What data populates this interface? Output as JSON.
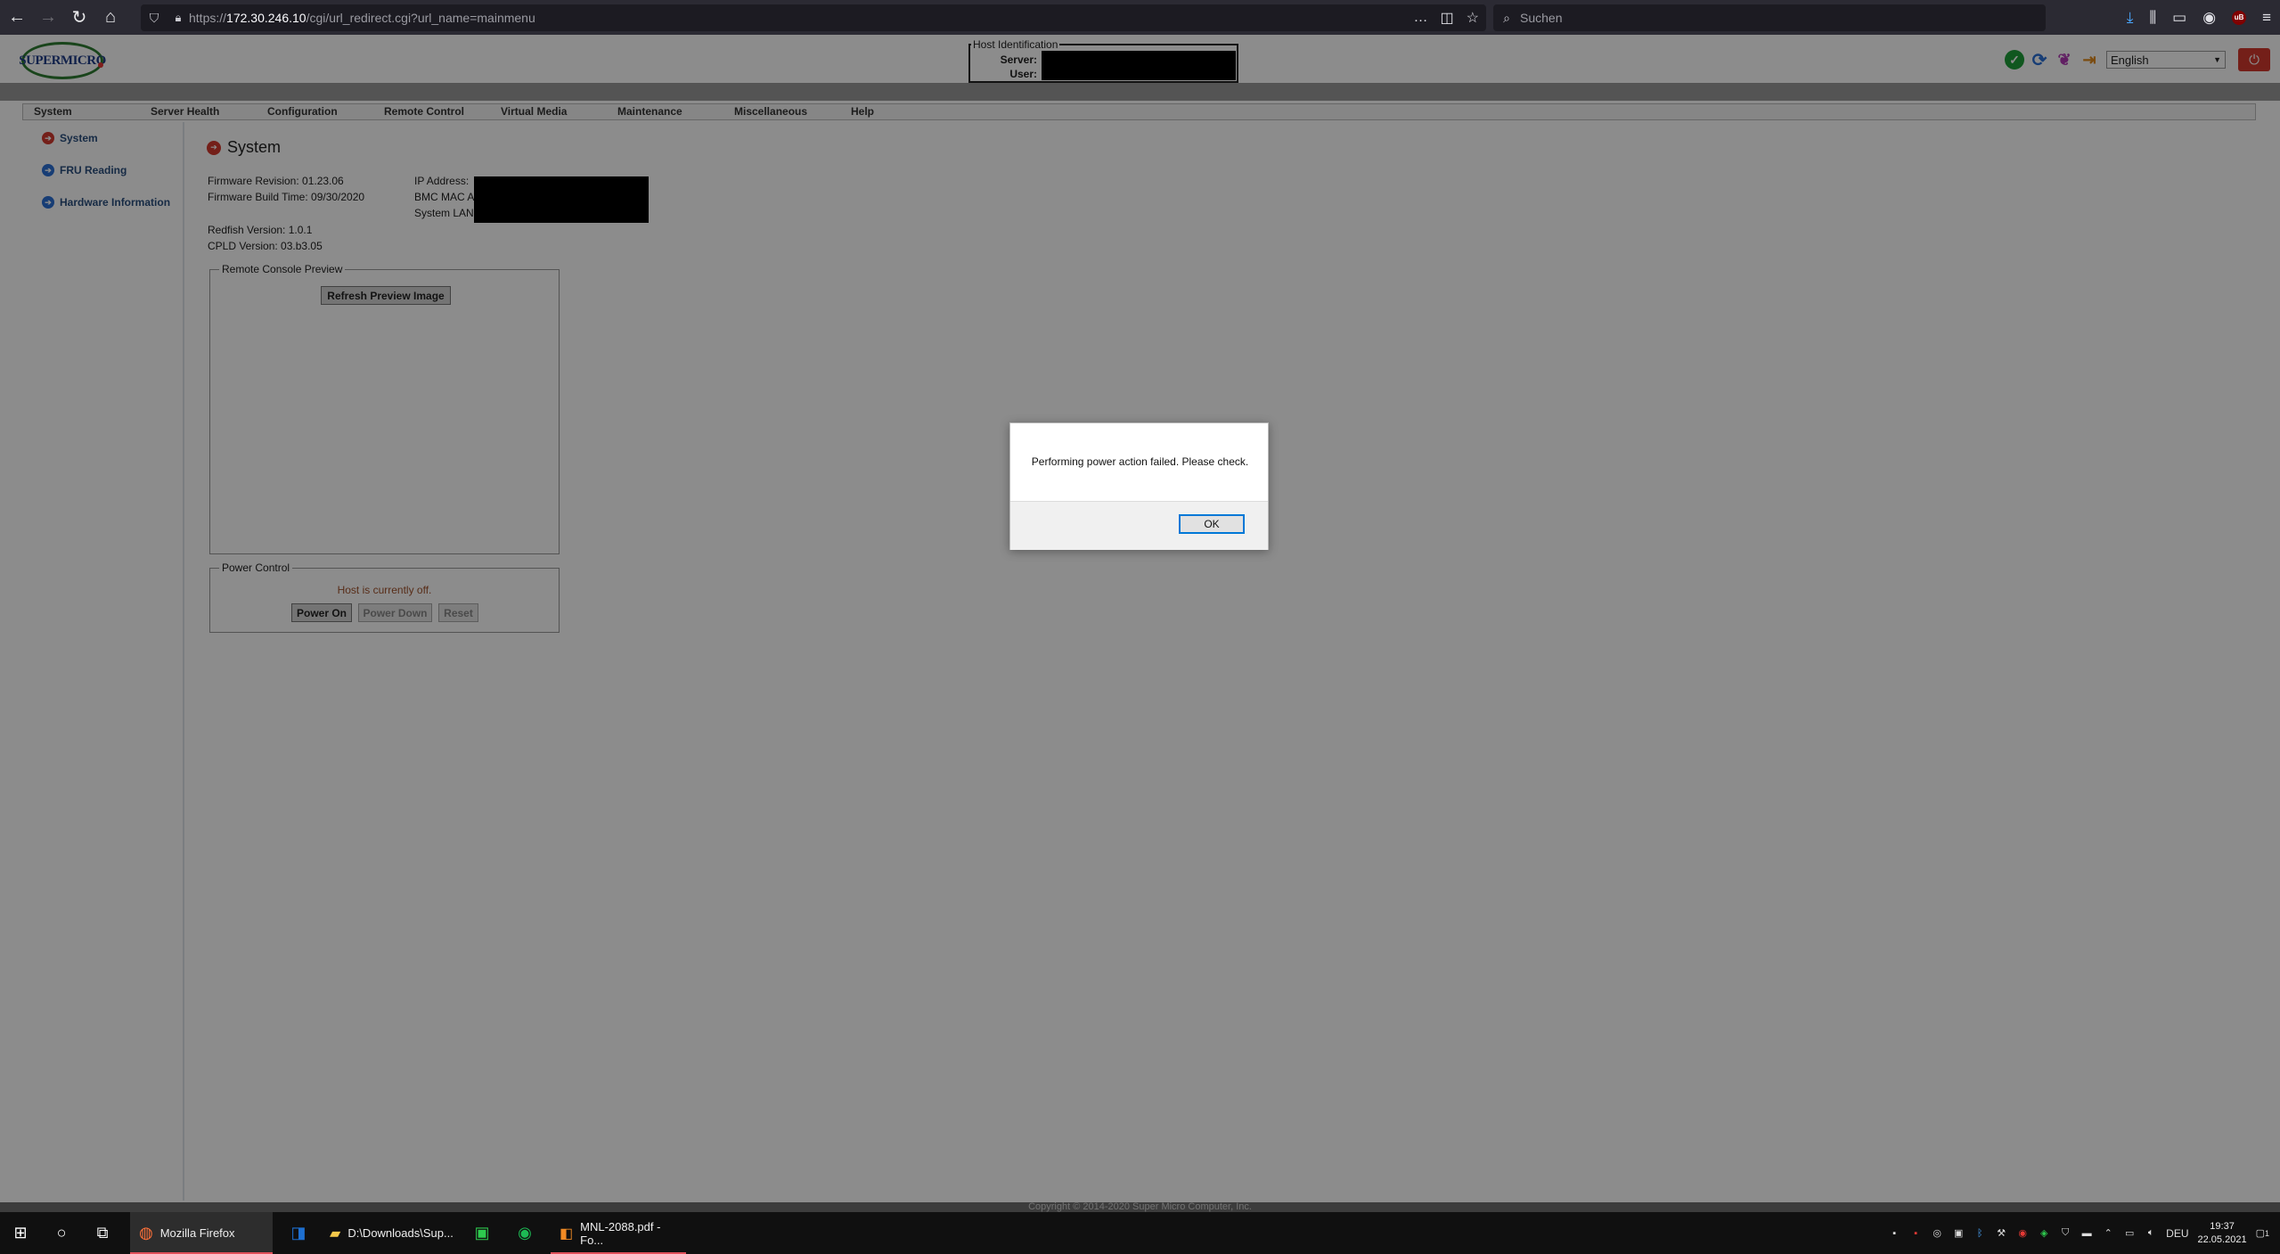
{
  "browser": {
    "url_prefix": "https://",
    "url_host": "172.30.246.10",
    "url_path": "/cgi/url_redirect.cgi?url_name=mainmenu",
    "search_placeholder": "Suchen",
    "more_icon": "…"
  },
  "header": {
    "logo_text": "SUPERMICRO",
    "host_identification": {
      "legend": "Host Identification",
      "server_label": "Server:",
      "user_label": "User:"
    },
    "language": "English"
  },
  "menu": [
    "System",
    "Server Health",
    "Configuration",
    "Remote Control",
    "Virtual Media",
    "Maintenance",
    "Miscellaneous",
    "Help"
  ],
  "sidebar": {
    "items": [
      {
        "label": "System",
        "icon": "arrow-right-red-icon"
      },
      {
        "label": "FRU Reading",
        "icon": "arrow-right-blue-icon"
      },
      {
        "label": "Hardware Information",
        "icon": "arrow-right-blue-icon"
      }
    ]
  },
  "system": {
    "title": "System",
    "firmware_revision": "Firmware Revision: 01.23.06",
    "firmware_build_time": "Firmware Build Time: 09/30/2020",
    "ip_address_label": "IP Address:",
    "bmc_mac_label": "BMC MAC Ad",
    "system_lan_label": "System LAN",
    "redfish_version": "Redfish Version: 1.0.1",
    "cpld_version": "CPLD Version: 03.b3.05"
  },
  "remote_console": {
    "legend": "Remote Console Preview",
    "refresh_button": "Refresh Preview Image"
  },
  "power_control": {
    "legend": "Power Control",
    "status": "Host is currently off.",
    "power_on": "Power On",
    "power_down": "Power Down",
    "reset": "Reset"
  },
  "footer": "Copyright © 2014-2020 Super Micro Computer, Inc.",
  "dialog": {
    "message": "Performing power action failed. Please check.",
    "ok": "OK"
  },
  "taskbar": {
    "apps": [
      {
        "label": "Mozilla Firefox"
      },
      {
        "label": "D:\\Downloads\\Sup..."
      },
      {
        "label": "MNL-2088.pdf - Fo..."
      }
    ],
    "tray": {
      "language": "DEU",
      "time": "19:37",
      "date": "22.05.2021",
      "notification_count": "1"
    }
  },
  "colors": {
    "accent_red": "#d43a2f",
    "sidebar_link": "#2a4f7f",
    "status_text": "#a0522d"
  }
}
